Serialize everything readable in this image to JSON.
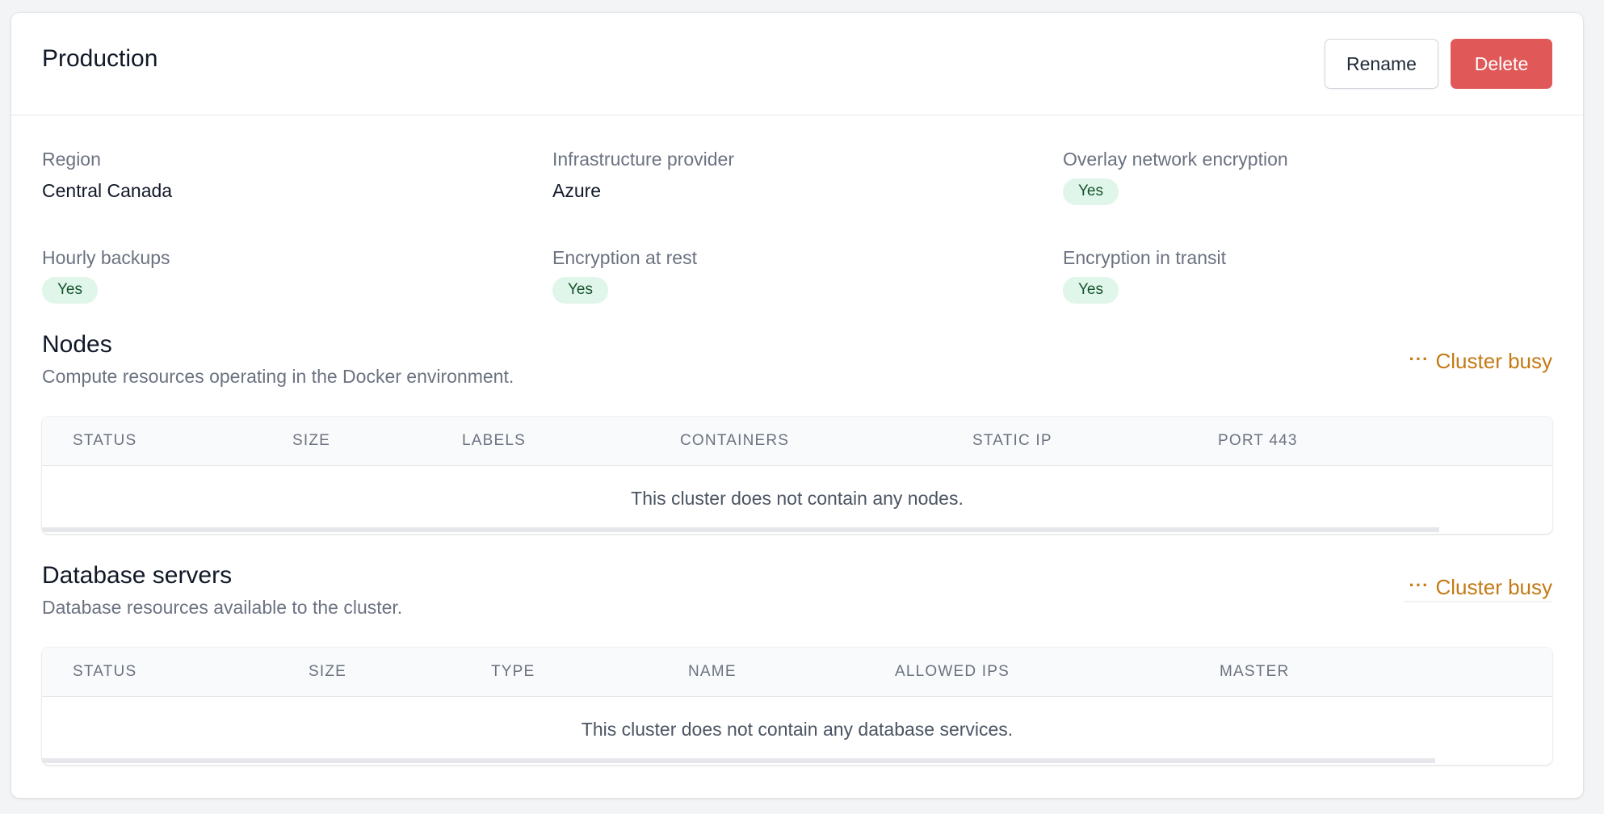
{
  "header": {
    "title": "Production",
    "rename_label": "Rename",
    "delete_label": "Delete"
  },
  "details": {
    "region": {
      "label": "Region",
      "value": "Central Canada"
    },
    "provider": {
      "label": "Infrastructure provider",
      "value": "Azure"
    },
    "overlay": {
      "label": "Overlay network encryption",
      "value": "Yes"
    },
    "backups": {
      "label": "Hourly backups",
      "value": "Yes"
    },
    "at_rest": {
      "label": "Encryption at rest",
      "value": "Yes"
    },
    "in_transit": {
      "label": "Encryption in transit",
      "value": "Yes"
    }
  },
  "nodes": {
    "title": "Nodes",
    "description": "Compute resources operating in the Docker environment.",
    "status": "Cluster busy",
    "columns": [
      "Status",
      "Size",
      "Labels",
      "Containers",
      "Static IP",
      "Port 443"
    ],
    "empty": "This cluster does not contain any nodes."
  },
  "databases": {
    "title": "Database servers",
    "description": "Database resources available to the cluster.",
    "status": "Cluster busy",
    "columns": [
      "Status",
      "Size",
      "Type",
      "Name",
      "Allowed IPs",
      "Master"
    ],
    "empty": "This cluster does not contain any database services."
  },
  "colors": {
    "danger": "#e05858",
    "busy": "#c47a14",
    "badge_bg": "#e1f6ea",
    "badge_text": "#14532d"
  }
}
